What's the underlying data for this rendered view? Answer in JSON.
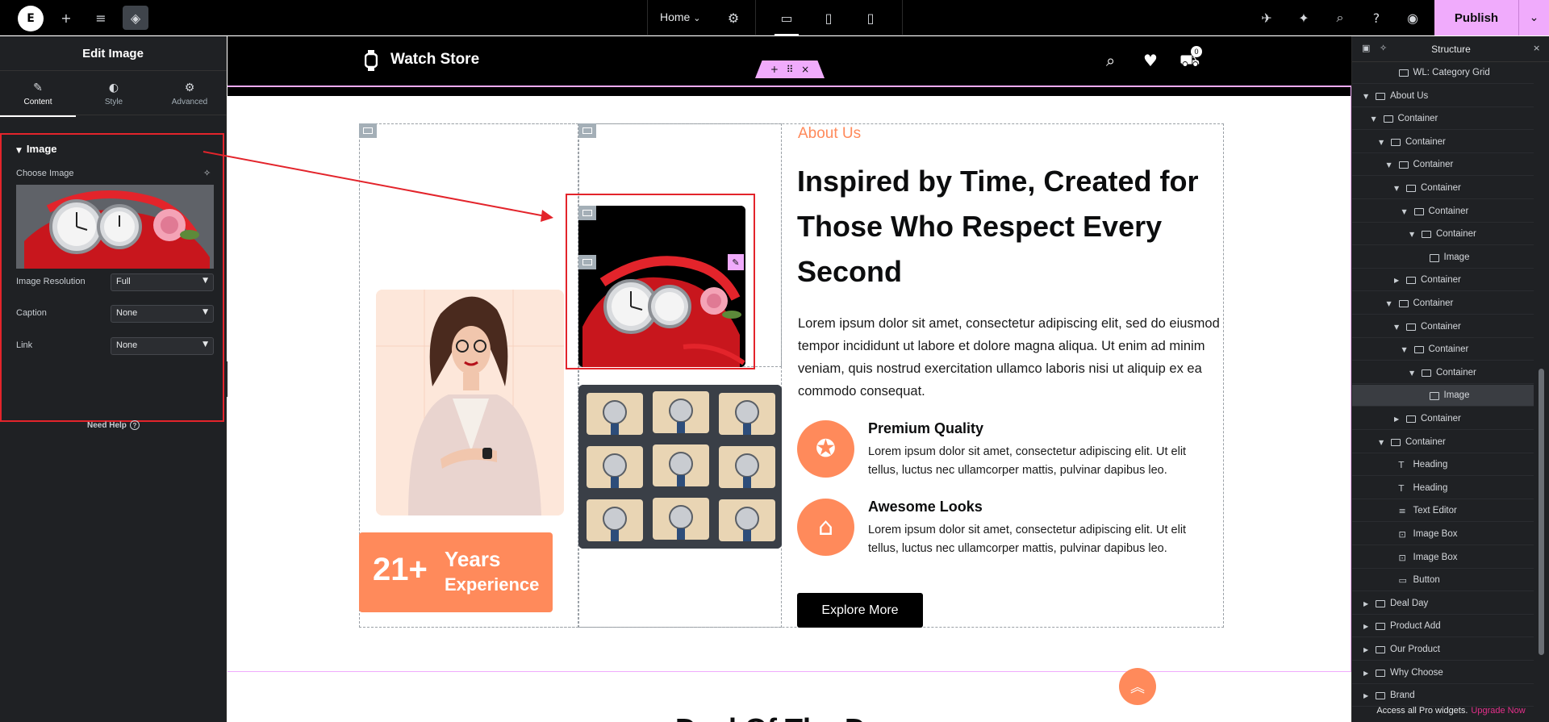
{
  "topbar": {
    "page_name": "Home",
    "publish_label": "Publish",
    "icons": [
      "elementor-logo-icon",
      "add-icon",
      "settings-sliders-icon",
      "layers-icon",
      "gear-icon",
      "desktop-icon",
      "tablet-icon",
      "mobile-icon",
      "rocket-icon",
      "notifications-icon",
      "search-icon",
      "help-icon",
      "preview-eye-icon",
      "chevron-down-icon"
    ]
  },
  "left_panel": {
    "title": "Edit Image",
    "tabs": [
      {
        "label": "Content",
        "icon": "pencil-icon",
        "active": true
      },
      {
        "label": "Style",
        "icon": "half-circle-icon",
        "active": false
      },
      {
        "label": "Advanced",
        "icon": "gear-icon",
        "active": false
      }
    ],
    "section_title": "Image",
    "choose_image_label": "Choose Image",
    "fields": [
      {
        "label": "Image Resolution",
        "value": "Full"
      },
      {
        "label": "Caption",
        "value": "None"
      },
      {
        "label": "Link",
        "value": "None"
      }
    ],
    "need_help": "Need Help"
  },
  "site": {
    "brand": "Watch Store",
    "cart_count": "0",
    "about_eyebrow": "About Us",
    "about_title": "Inspired by Time, Created for Those Who Respect Every Second",
    "about_body": "Lorem ipsum dolor sit amet, consectetur adipiscing elit, sed do eiusmod tempor incididunt ut labore et dolore magna aliqua. Ut enim ad minim veniam, quis nostrud exercitation ullamco laboris nisi ut aliquip ex ea commodo consequat.",
    "features": [
      {
        "title": "Premium Quality",
        "body": "Lorem ipsum dolor sit amet, consectetur adipiscing elit. Ut elit tellus, luctus nec ullamcorper mattis, pulvinar dapibus leo.",
        "icon": "badge-icon"
      },
      {
        "title": "Awesome Looks",
        "body": "Lorem ipsum dolor sit amet, consectetur adipiscing elit. Ut elit tellus, luctus nec ullamcorper mattis, pulvinar dapibus leo.",
        "icon": "shop-icon"
      }
    ],
    "button_label": "Explore More",
    "years_number": "21+",
    "years_line1": "Years",
    "years_line2": "Experience",
    "next_heading": "Deal Of The Day"
  },
  "structure": {
    "title": "Structure",
    "nodes": [
      {
        "label": "WL: Category Grid",
        "depth": 4,
        "caret": "",
        "icon": "widget"
      },
      {
        "label": "About Us",
        "depth": 1,
        "caret": "down",
        "icon": "box"
      },
      {
        "label": "Container",
        "depth": 2,
        "caret": "down",
        "icon": "box"
      },
      {
        "label": "Container",
        "depth": 3,
        "caret": "down",
        "icon": "box"
      },
      {
        "label": "Container",
        "depth": 4,
        "caret": "down",
        "icon": "box"
      },
      {
        "label": "Container",
        "depth": 5,
        "caret": "down",
        "icon": "box"
      },
      {
        "label": "Container",
        "depth": 6,
        "caret": "down",
        "icon": "box"
      },
      {
        "label": "Container",
        "depth": 7,
        "caret": "down",
        "icon": "box"
      },
      {
        "label": "Image",
        "depth": 8,
        "caret": "",
        "icon": "image"
      },
      {
        "label": "Container",
        "depth": 5,
        "caret": "right",
        "icon": "box"
      },
      {
        "label": "Container",
        "depth": 4,
        "caret": "down",
        "icon": "box"
      },
      {
        "label": "Container",
        "depth": 5,
        "caret": "down",
        "icon": "box"
      },
      {
        "label": "Container",
        "depth": 6,
        "caret": "down",
        "icon": "box"
      },
      {
        "label": "Container",
        "depth": 7,
        "caret": "down",
        "icon": "box"
      },
      {
        "label": "Image",
        "depth": 8,
        "caret": "",
        "icon": "image",
        "selected": true
      },
      {
        "label": "Container",
        "depth": 5,
        "caret": "right",
        "icon": "box"
      },
      {
        "label": "Container",
        "depth": 3,
        "caret": "down",
        "icon": "box"
      },
      {
        "label": "Heading",
        "depth": 4,
        "caret": "",
        "icon": "heading"
      },
      {
        "label": "Heading",
        "depth": 4,
        "caret": "",
        "icon": "heading"
      },
      {
        "label": "Text Editor",
        "depth": 4,
        "caret": "",
        "icon": "text"
      },
      {
        "label": "Image Box",
        "depth": 4,
        "caret": "",
        "icon": "imagebox"
      },
      {
        "label": "Image Box",
        "depth": 4,
        "caret": "",
        "icon": "imagebox"
      },
      {
        "label": "Button",
        "depth": 4,
        "caret": "",
        "icon": "button"
      },
      {
        "label": "Deal Day",
        "depth": 1,
        "caret": "right",
        "icon": "box"
      },
      {
        "label": "Product Add",
        "depth": 1,
        "caret": "right",
        "icon": "box"
      },
      {
        "label": "Our Product",
        "depth": 1,
        "caret": "right",
        "icon": "box"
      },
      {
        "label": "Why Choose",
        "depth": 1,
        "caret": "right",
        "icon": "box"
      },
      {
        "label": "Brand",
        "depth": 1,
        "caret": "right",
        "icon": "box"
      }
    ],
    "footer_text": "Access all Pro widgets.",
    "footer_link": "Upgrade Now"
  },
  "colors": {
    "accent_pink": "#f0abfc",
    "brand_orange": "#ff8a5b",
    "annotation_red": "#e3242b",
    "panel_bg": "#1f2124"
  }
}
